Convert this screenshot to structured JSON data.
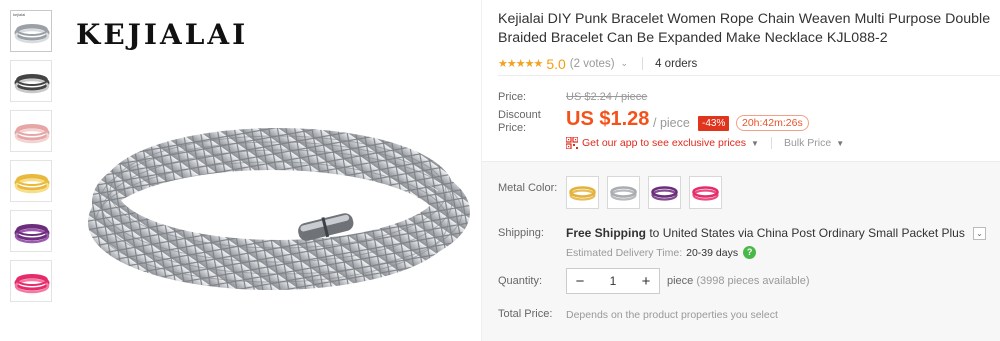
{
  "brand": "KEJIALAI",
  "thumbnails": [
    {
      "label": "kejialai",
      "color": "#9aa0a6",
      "accent": "#d9dcdf"
    },
    {
      "color": "#444444",
      "accent": "#c8c8c8"
    },
    {
      "color": "#e6a6a6",
      "accent": "#f3d2d2"
    },
    {
      "color": "#e8b93a",
      "accent": "#f6dd88"
    },
    {
      "color": "#6b2d7c",
      "accent": "#9b5ab0"
    },
    {
      "color": "#e62b6b",
      "accent": "#f47aa2"
    }
  ],
  "product": {
    "title": "Kejialai DIY Punk Bracelet Women Rope Chain Weaven Multi Purpose Double Braided Bracelet Can Be Expanded Make Necklace KJL088-2",
    "stars": "★★★★★",
    "rating": "5.0",
    "votes": "(2 votes)",
    "orders": "4 orders"
  },
  "price": {
    "price_label": "Price:",
    "original": "US $2.24 / piece",
    "discount_label": "Discount Price:",
    "current": "US $1.28",
    "unit": "/ piece",
    "badge": "-43%",
    "timer": "20h:42m:26s",
    "app_deal": "Get our app to see exclusive prices",
    "bulk": "Bulk Price"
  },
  "options": {
    "color_label": "Metal Color:",
    "swatches": [
      {
        "name": "gold",
        "color": "#e3b23c"
      },
      {
        "name": "silver",
        "color": "#a9adb1"
      },
      {
        "name": "purple",
        "color": "#6b2d7c"
      },
      {
        "name": "rose",
        "color": "#e62b6b"
      }
    ]
  },
  "shipping": {
    "label": "Shipping:",
    "free": "Free Shipping",
    "rest": " to United States via China Post Ordinary Small Packet Plus",
    "est_label": "Estimated Delivery Time:",
    "est_days": "20-39 days"
  },
  "quantity": {
    "label": "Quantity:",
    "value": "1",
    "unit": "piece",
    "available": "(3998 pieces available)"
  },
  "total": {
    "label": "Total Price:",
    "text": "Depends on the product properties you select"
  },
  "icons": {
    "minus": "−",
    "plus": "+",
    "caret": "⌄",
    "dd_caret": "▼",
    "help": "?",
    "ship_dd": "⌄"
  }
}
